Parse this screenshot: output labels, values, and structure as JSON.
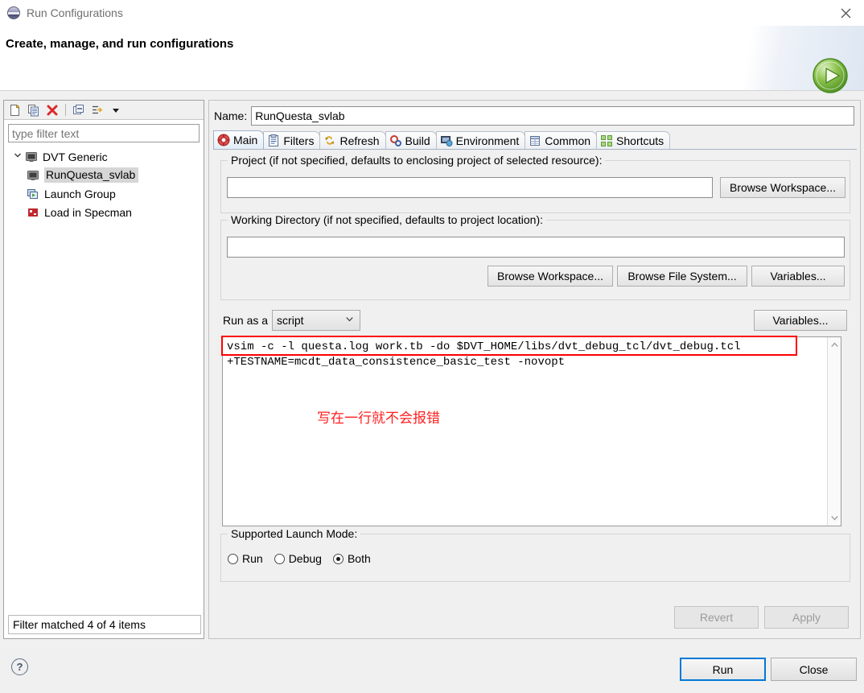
{
  "window": {
    "title": "Run Configurations",
    "icon": "eclipse-run-icon",
    "close_label": "×"
  },
  "header": {
    "title": "Create, manage, and run configurations",
    "badge_icon": "green-run-play-icon"
  },
  "left_panel": {
    "toolbar": [
      {
        "name": "new-configuration-icon",
        "title": "New launch configuration"
      },
      {
        "name": "duplicate-configuration-icon",
        "title": "Duplicate"
      },
      {
        "name": "delete-configuration-icon",
        "title": "Delete"
      },
      {
        "name": "collapse-all-icon",
        "title": "Collapse All"
      },
      {
        "name": "filter-icon",
        "title": "Filter launch configurations"
      },
      {
        "name": "view-menu-arrow-icon",
        "title": "View Menu"
      }
    ],
    "filter": {
      "placeholder": "type filter text",
      "value": ""
    },
    "tree": [
      {
        "label": "DVT Generic",
        "icon": "monitor-icon",
        "indent": 0,
        "expanded": true,
        "selected": false
      },
      {
        "label": "RunQuesta_svlab",
        "icon": "monitor-icon",
        "indent": 1,
        "expanded": null,
        "selected": true
      },
      {
        "label": "Launch Group",
        "icon": "launch-group-icon",
        "indent": 0,
        "expanded": null,
        "selected": false
      },
      {
        "label": "Load in Specman",
        "icon": "specman-icon",
        "indent": 0,
        "expanded": null,
        "selected": false
      }
    ],
    "status": "Filter matched 4 of 4 items"
  },
  "right_panel": {
    "name_label": "Name:",
    "name_value": "RunQuesta_svlab",
    "tabs": [
      {
        "label": "Main",
        "icon": "main-target-icon",
        "active": true
      },
      {
        "label": "Filters",
        "icon": "filters-list-icon",
        "active": false
      },
      {
        "label": "Refresh",
        "icon": "refresh-icon",
        "active": false
      },
      {
        "label": "Build",
        "icon": "build-gears-icon",
        "active": false
      },
      {
        "label": "Environment",
        "icon": "environment-icon",
        "active": false
      },
      {
        "label": "Common",
        "icon": "common-table-icon",
        "active": false
      },
      {
        "label": "Shortcuts",
        "icon": "shortcuts-icon",
        "active": false
      }
    ],
    "project_group": {
      "title": "Project (if not specified, defaults to enclosing project of selected resource):",
      "input_value": "",
      "browse_workspace_label": "Browse Workspace..."
    },
    "working_dir_group": {
      "title": "Working Directory (if not specified, defaults to project location):",
      "input_value": "",
      "browse_workspace_label": "Browse Workspace...",
      "browse_filesystem_label": "Browse File System...",
      "variables_label": "Variables..."
    },
    "run_as": {
      "label": "Run as a",
      "selected": "script",
      "options": [
        "script"
      ],
      "variables_label": "Variables..."
    },
    "script": {
      "line1": "vsim -c -l questa.log work.tb -do $DVT_HOME/libs/dvt_debug_tcl/dvt_debug.tcl",
      "line2": "+TESTNAME=mcdt_data_consistence_basic_test -novopt",
      "annotation": "写在一行就不会报错",
      "annotation_color": "#ff2020",
      "highlight_color": "#ff0000",
      "scroll_up": "∧",
      "scroll_down": "∨"
    },
    "launch_mode": {
      "title": "Supported Launch Mode:",
      "options": [
        {
          "label": "Run",
          "selected": false
        },
        {
          "label": "Debug",
          "selected": false
        },
        {
          "label": "Both",
          "selected": true
        }
      ]
    },
    "revert_label": "Revert",
    "apply_label": "Apply"
  },
  "footer": {
    "help_icon": "?",
    "run_label": "Run",
    "close_label": "Close"
  }
}
